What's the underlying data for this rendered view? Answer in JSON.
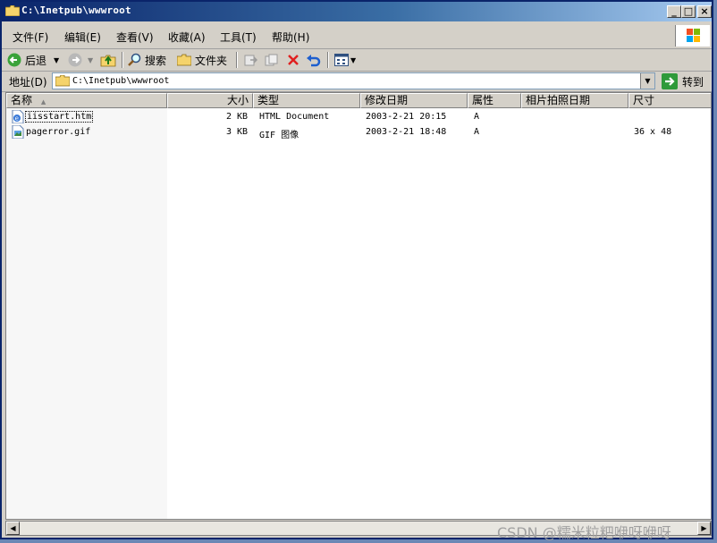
{
  "window": {
    "title": "C:\\Inetpub\\wwwroot",
    "controls": {
      "minimize": "_",
      "maximize": "□",
      "close": "×"
    }
  },
  "menu": {
    "items": [
      "文件(F)",
      "编辑(E)",
      "查看(V)",
      "收藏(A)",
      "工具(T)",
      "帮助(H)"
    ]
  },
  "toolbar": {
    "back_label": "后退",
    "search_label": "搜索",
    "folders_label": "文件夹"
  },
  "address": {
    "label": "地址(D)",
    "value": "C:\\Inetpub\\wwwroot",
    "go_label": "转到"
  },
  "columns": [
    "名称",
    "大小",
    "类型",
    "修改日期",
    "属性",
    "相片拍照日期",
    "尺寸"
  ],
  "files": [
    {
      "name": "iisstart.htm",
      "size": "2 KB",
      "type": "HTML Document",
      "modified": "2003-2-21 20:15",
      "attr": "A",
      "photo_date": "",
      "dimensions": ""
    },
    {
      "name": "pagerror.gif",
      "size": "3 KB",
      "type": "GIF 图像",
      "modified": "2003-2-21 18:48",
      "attr": "A",
      "photo_date": "",
      "dimensions": "36 x 48"
    }
  ],
  "watermark": "CSDN @糯米粒粑咿呀咿呀",
  "colors": {
    "titlebar_start": "#0a246a",
    "titlebar_end": "#a6caf0",
    "chrome": "#d4d0c8"
  }
}
